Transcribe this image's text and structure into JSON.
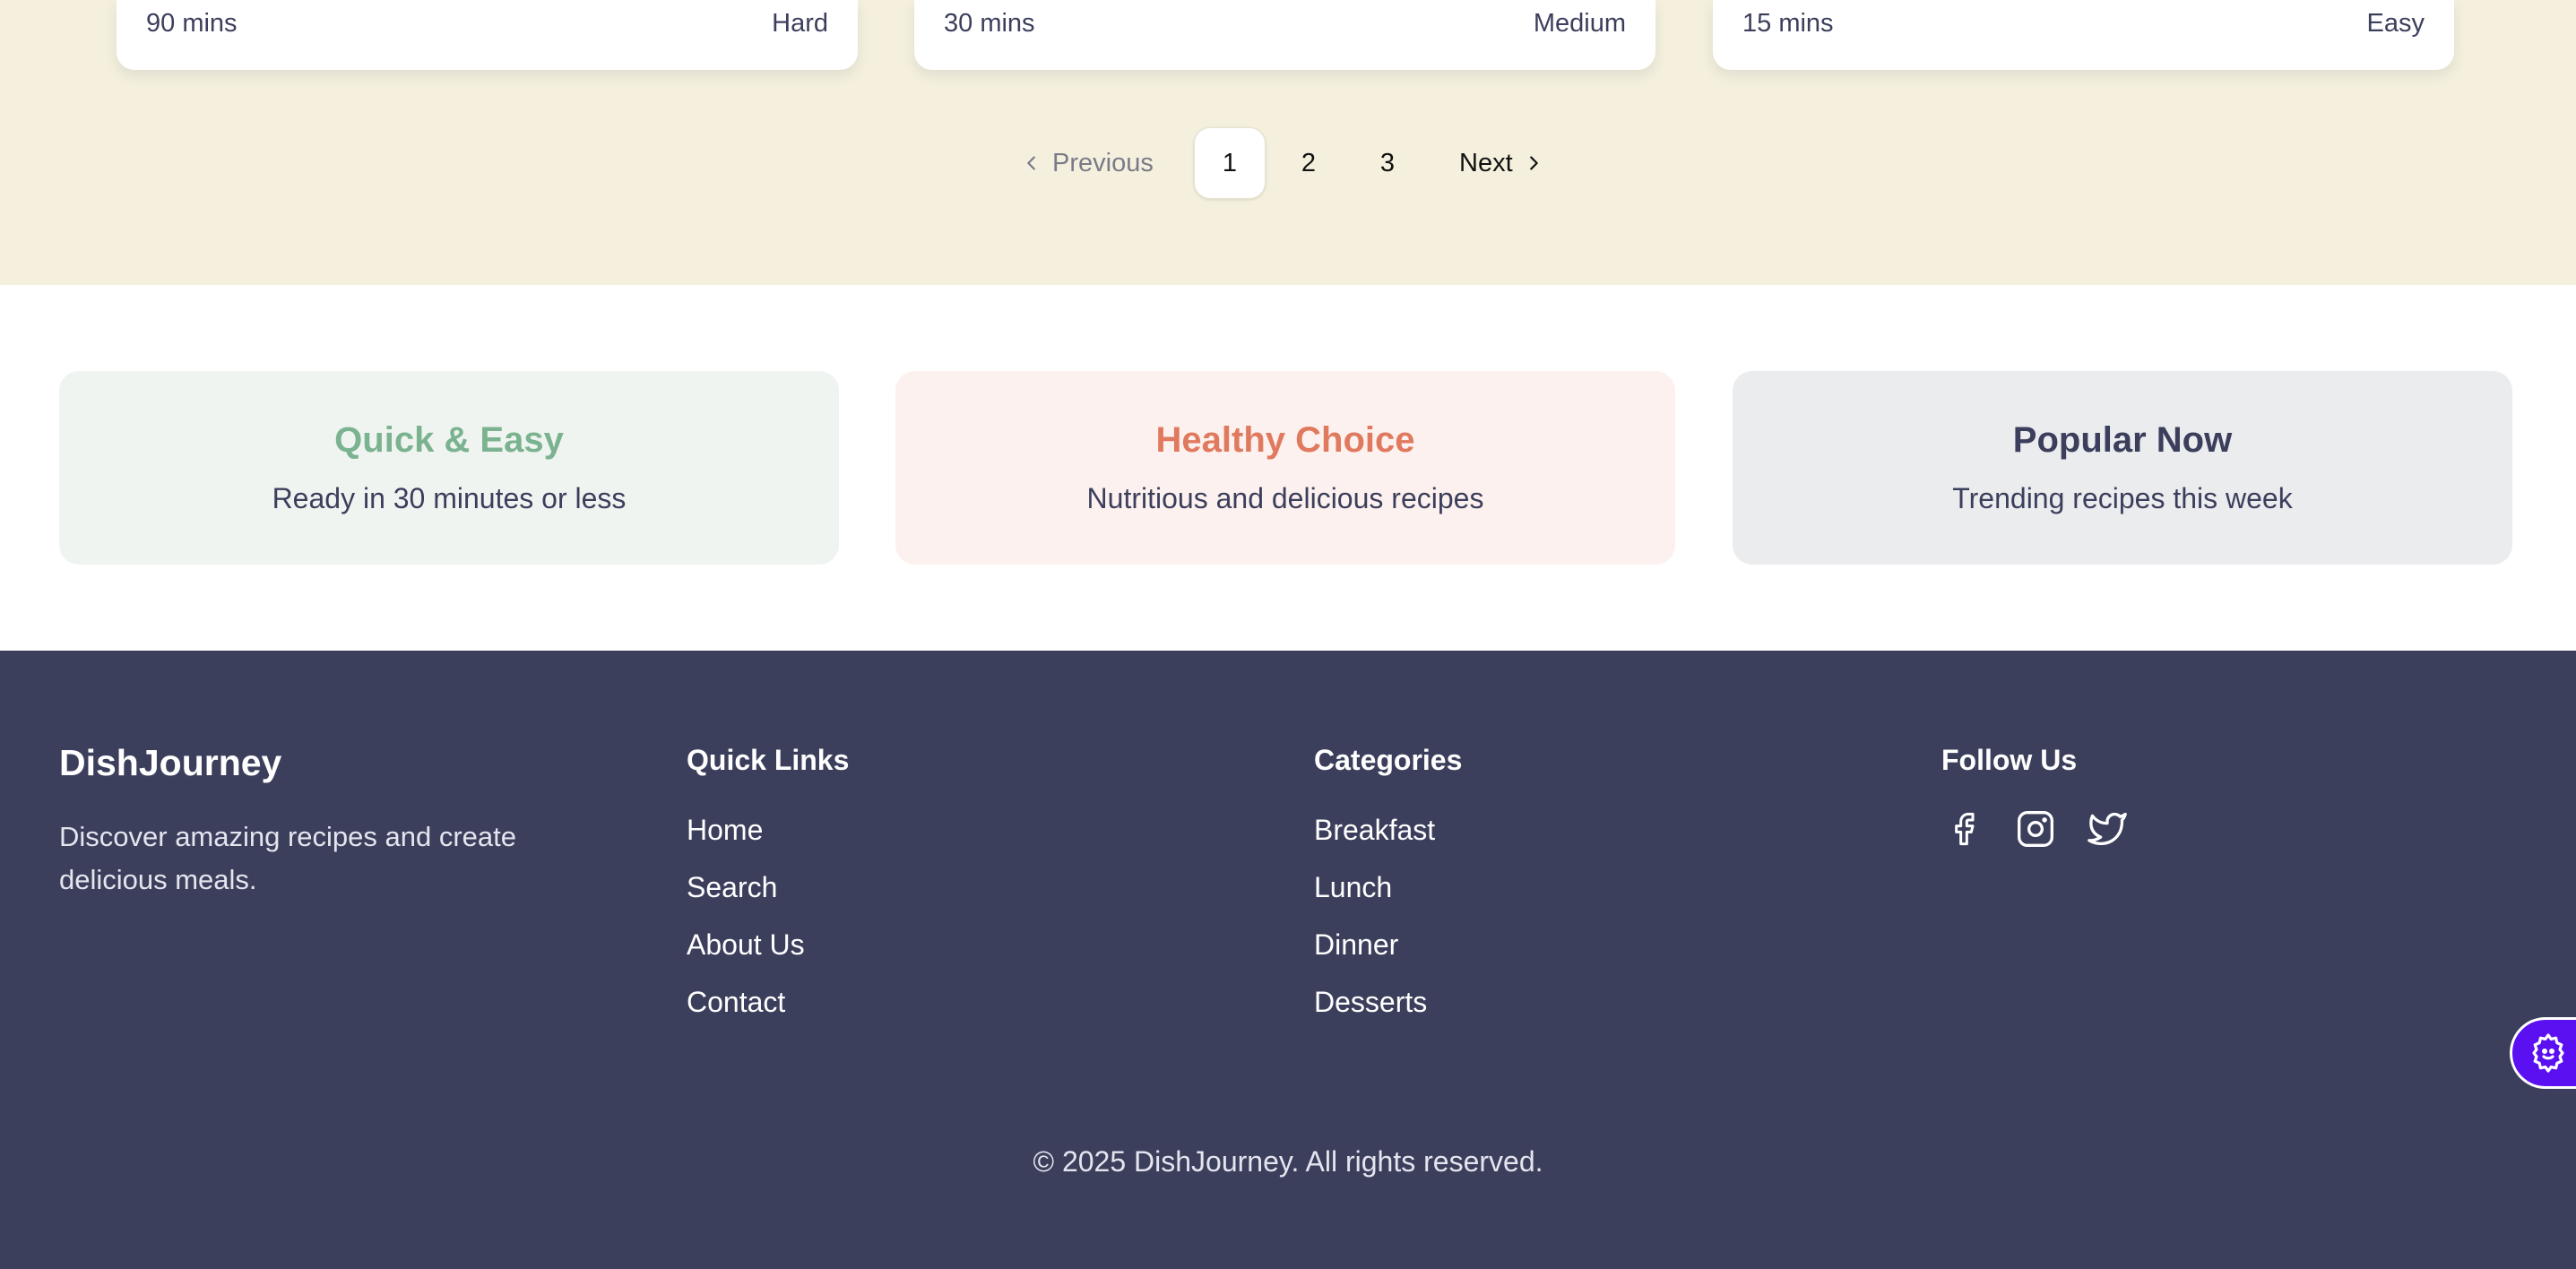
{
  "recipe_cards": [
    {
      "time": "90 mins",
      "difficulty": "Hard"
    },
    {
      "time": "30 mins",
      "difficulty": "Medium"
    },
    {
      "time": "15 mins",
      "difficulty": "Easy"
    }
  ],
  "pagination": {
    "previous_label": "Previous",
    "next_label": "Next",
    "pages": [
      "1",
      "2",
      "3"
    ],
    "current_page": "1"
  },
  "features": [
    {
      "title": "Quick & Easy",
      "subtitle": "Ready in 30 minutes or less",
      "title_color": "#7bb390",
      "bg_color": "#f0f4f1"
    },
    {
      "title": "Healthy Choice",
      "subtitle": "Nutritious and delicious recipes",
      "title_color": "#e07a5f",
      "bg_color": "#fcf1ee"
    },
    {
      "title": "Popular Now",
      "subtitle": "Trending recipes this week",
      "title_color": "#3c3f5c",
      "bg_color": "#ebecee"
    }
  ],
  "footer": {
    "brand": "DishJourney",
    "tagline": "Discover amazing recipes and create delicious meals.",
    "quick_links": {
      "heading": "Quick Links",
      "items": [
        "Home",
        "Search",
        "About Us",
        "Contact"
      ]
    },
    "categories": {
      "heading": "Categories",
      "items": [
        "Breakfast",
        "Lunch",
        "Dinner",
        "Desserts"
      ]
    },
    "follow": {
      "heading": "Follow Us",
      "icons": [
        "facebook-icon",
        "instagram-icon",
        "twitter-icon"
      ]
    },
    "copyright": "© 2025 DishJourney. All rights reserved."
  },
  "colors": {
    "cream": "#f4f0dd",
    "navy": "#3c3f5c",
    "accent_green": "#7bb390",
    "accent_coral": "#e07a5f",
    "fab_purple": "#5b10f2"
  }
}
